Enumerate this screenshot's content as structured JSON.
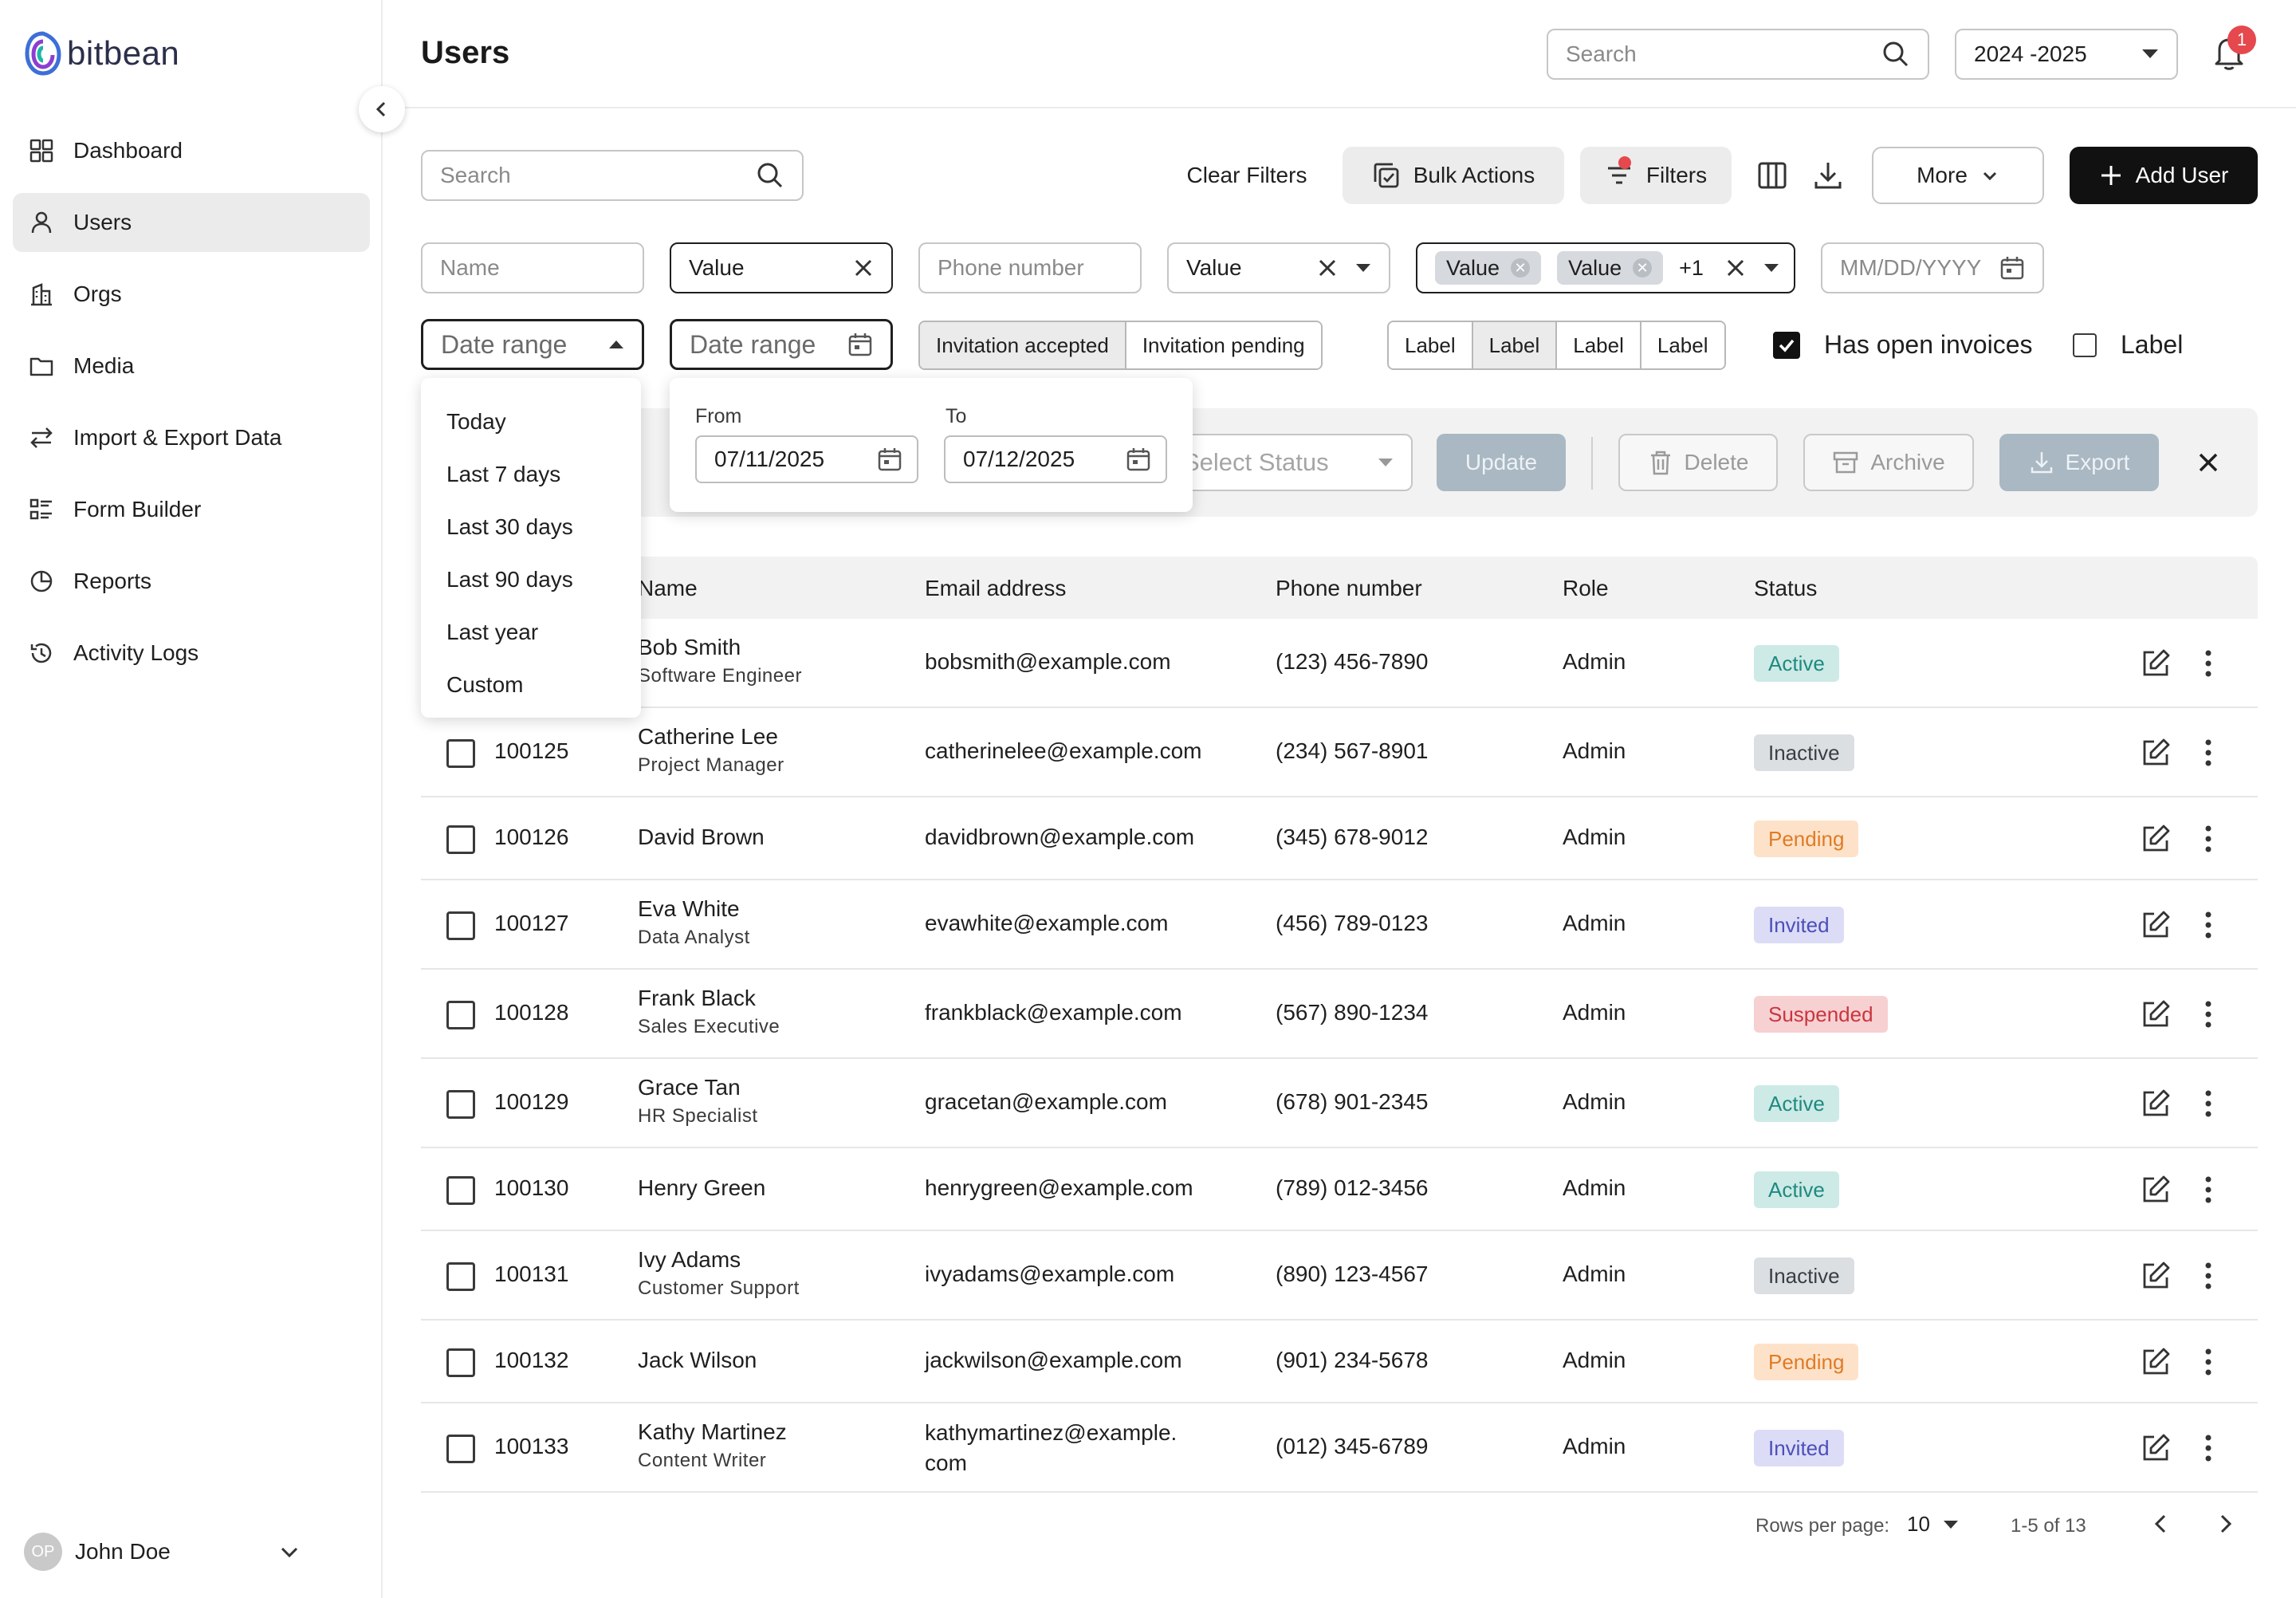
{
  "app": {
    "name": "bitbean"
  },
  "sidebar": {
    "items": [
      {
        "label": "Dashboard",
        "icon": "grid-icon"
      },
      {
        "label": "Users",
        "icon": "user-icon"
      },
      {
        "label": "Orgs",
        "icon": "building-icon"
      },
      {
        "label": "Media",
        "icon": "folder-icon"
      },
      {
        "label": "Import & Export Data",
        "icon": "arrows-icon"
      },
      {
        "label": "Form Builder",
        "icon": "form-icon"
      },
      {
        "label": "Reports",
        "icon": "pie-icon"
      },
      {
        "label": "Activity Logs",
        "icon": "history-icon"
      }
    ],
    "active": "Users",
    "user": {
      "initials": "OP",
      "name": "John Doe"
    }
  },
  "header": {
    "title": "Users",
    "search_placeholder": "Search",
    "year": "2024 -2025",
    "notification_count": "1"
  },
  "toolbar": {
    "search_placeholder": "Search",
    "clear_filters": "Clear Filters",
    "bulk_actions": "Bulk Actions",
    "filters": "Filters",
    "more": "More",
    "add_user": "Add User"
  },
  "filters": {
    "name_placeholder": "Name",
    "value1": "Value",
    "phone_placeholder": "Phone number",
    "value2": "Value",
    "chip1": "Value",
    "chip2": "Value",
    "chip_more": "+1",
    "date_placeholder": "MM/DD/YYYY",
    "date_range_select": "Date range",
    "date_range_input": "Date range",
    "invitation": [
      "Invitation accepted",
      "Invitation pending"
    ],
    "labels": [
      "Label",
      "Label",
      "Label",
      "Label"
    ],
    "has_open_invoices": "Has open invoices",
    "label_checkbox": "Label"
  },
  "date_dropdown": {
    "options": [
      "Today",
      "Last 7 days",
      "Last 30 days",
      "Last 90 days",
      "Last year",
      "Custom"
    ]
  },
  "range_popover": {
    "from_label": "From",
    "from_value": "07/11/2025",
    "to_label": "To",
    "to_value": "07/12/2025"
  },
  "bulk_bar": {
    "select_status": "Select Status",
    "update": "Update",
    "delete": "Delete",
    "archive": "Archive",
    "export": "Export"
  },
  "table": {
    "headers": {
      "name": "Name",
      "email": "Email address",
      "phone": "Phone number",
      "role": "Role",
      "status": "Status"
    },
    "rows": [
      {
        "id": "",
        "name": "Bob Smith",
        "title": "Software Engineer",
        "email": "bobsmith@example.com",
        "phone": "(123) 456-7890",
        "role": "Admin",
        "status": "Active"
      },
      {
        "id": "100125",
        "name": "Catherine Lee",
        "title": "Project Manager",
        "email": "catherinelee@example.com",
        "phone": "(234) 567-8901",
        "role": "Admin",
        "status": "Inactive"
      },
      {
        "id": "100126",
        "name": "David Brown",
        "title": "",
        "email": "davidbrown@example.com",
        "phone": "(345) 678-9012",
        "role": "Admin",
        "status": "Pending"
      },
      {
        "id": "100127",
        "name": "Eva White",
        "title": "Data Analyst",
        "email": "evawhite@example.com",
        "phone": "(456) 789-0123",
        "role": "Admin",
        "status": "Invited"
      },
      {
        "id": "100128",
        "name": "Frank Black",
        "title": "Sales Executive",
        "email": "frankblack@example.com",
        "phone": "(567) 890-1234",
        "role": "Admin",
        "status": "Suspended"
      },
      {
        "id": "100129",
        "name": "Grace Tan",
        "title": "HR Specialist",
        "email": "gracetan@example.com",
        "phone": "(678) 901-2345",
        "role": "Admin",
        "status": "Active"
      },
      {
        "id": "100130",
        "name": "Henry Green",
        "title": "",
        "email": "henrygreen@example.com",
        "phone": "(789) 012-3456",
        "role": "Admin",
        "status": "Active"
      },
      {
        "id": "100131",
        "name": "Ivy Adams",
        "title": "Customer Support",
        "email": "ivyadams@example.com",
        "phone": "(890) 123-4567",
        "role": "Admin",
        "status": "Inactive"
      },
      {
        "id": "100132",
        "name": "Jack Wilson",
        "title": "",
        "email": "jackwilson@example.com",
        "phone": "(901) 234-5678",
        "role": "Admin",
        "status": "Pending"
      },
      {
        "id": "100133",
        "name": "Kathy Martinez",
        "title": "Content Writer",
        "email": "kathymartinez@example.\ncom",
        "phone": "(012) 345-6789",
        "role": "Admin",
        "status": "Invited"
      }
    ]
  },
  "status_colors": {
    "Active": {
      "bg": "#cdeae6",
      "fg": "#1f8a80"
    },
    "Inactive": {
      "bg": "#dcdfe2",
      "fg": "#3a3f45"
    },
    "Pending": {
      "bg": "#fde2c9",
      "fg": "#e07b24"
    },
    "Invited": {
      "bg": "#dcdcf7",
      "fg": "#4b4fb8"
    },
    "Suspended": {
      "bg": "#f7d0d2",
      "fg": "#c9363f"
    }
  },
  "pagination": {
    "rows_per_page_label": "Rows per page:",
    "rows_per_page": "10",
    "range": "1-5 of 13"
  }
}
